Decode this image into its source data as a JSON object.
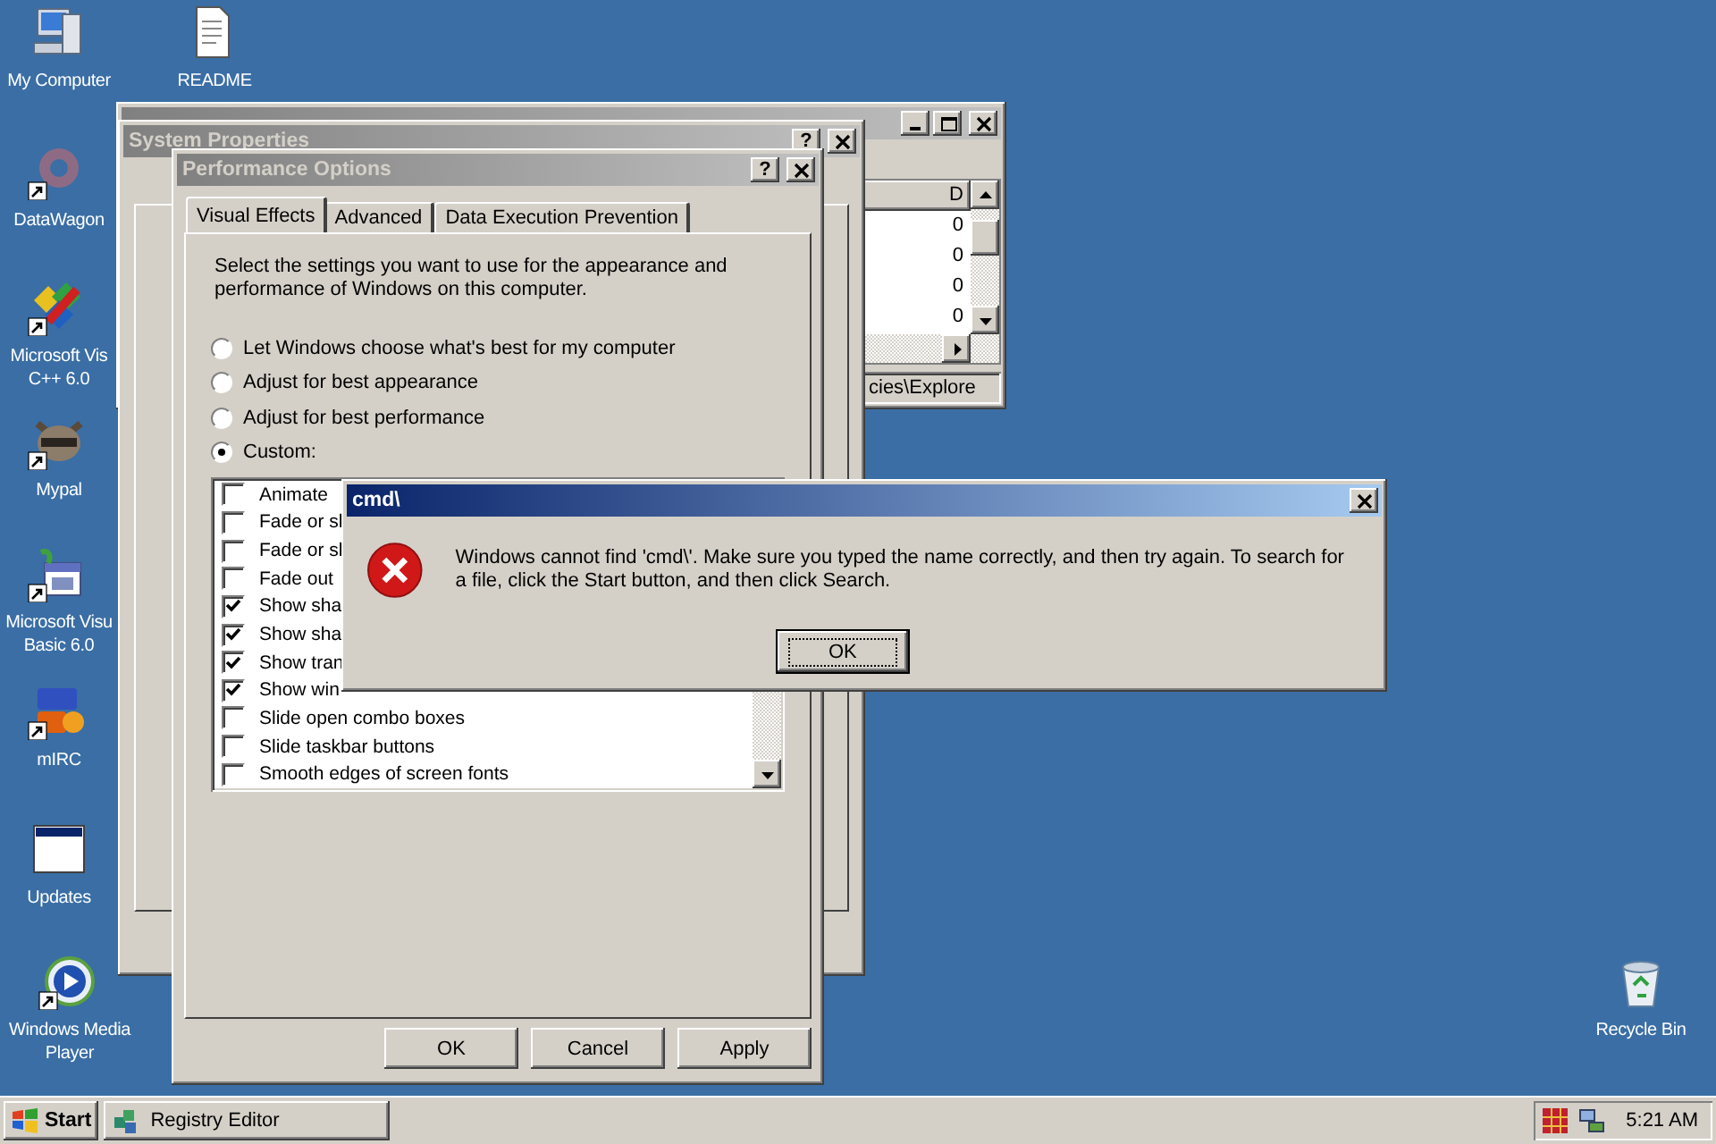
{
  "desktop_icons": [
    {
      "kind": "computer",
      "shortcut": false,
      "label_lines": [
        "My Computer"
      ]
    },
    {
      "kind": "document",
      "shortcut": false,
      "label_lines": [
        "README"
      ]
    },
    {
      "kind": "faded-disc",
      "shortcut": true,
      "label_lines": [
        "DataWagon"
      ]
    },
    {
      "kind": "tiles",
      "shortcut": true,
      "label_lines": [
        "Microsoft Vis",
        "C++ 6.0"
      ]
    },
    {
      "kind": "animal",
      "shortcut": true,
      "label_lines": [
        "Mypal"
      ]
    },
    {
      "kind": "calendar",
      "shortcut": true,
      "label_lines": [
        "Microsoft Visu",
        "Basic 6.0"
      ]
    },
    {
      "kind": "chat",
      "shortcut": true,
      "label_lines": [
        "mIRC"
      ]
    },
    {
      "kind": "window",
      "shortcut": false,
      "label_lines": [
        "Updates"
      ]
    },
    {
      "kind": "player",
      "shortcut": true,
      "label_lines": [
        "Windows Media",
        "Player"
      ]
    },
    {
      "kind": "bin",
      "shortcut": false,
      "label_lines": [
        "Recycle Bin"
      ]
    }
  ],
  "registry_editor": {
    "column_header": "D",
    "values": [
      "0",
      "0",
      "0",
      "0"
    ],
    "status": "cies\\Explore"
  },
  "system_properties": {
    "title": "System Properties",
    "help": "?"
  },
  "performance_options": {
    "title": "Performance Options",
    "help": "?",
    "tabs": [
      {
        "label": "Visual Effects",
        "selected": true
      },
      {
        "label": "Advanced",
        "selected": false
      },
      {
        "label": "Data Execution Prevention",
        "selected": false
      }
    ],
    "description": "Select the settings you want to use for the appearance and performance of Windows on this computer.",
    "radios": [
      {
        "label": "Let Windows choose what's best for my computer",
        "selected": false
      },
      {
        "label": "Adjust for best appearance",
        "selected": false
      },
      {
        "label": "Adjust for best performance",
        "selected": false
      },
      {
        "label": "Custom:",
        "selected": true
      }
    ],
    "checklist": [
      {
        "label": "Animate",
        "checked": false
      },
      {
        "label": "Fade or sl",
        "checked": false
      },
      {
        "label": "Fade or sl",
        "checked": false
      },
      {
        "label": "Fade out",
        "checked": false
      },
      {
        "label": "Show sha",
        "checked": true
      },
      {
        "label": "Show sha",
        "checked": true
      },
      {
        "label": "Show tran",
        "checked": true
      },
      {
        "label": "Show win",
        "checked": true
      },
      {
        "label": "Slide open combo boxes",
        "checked": false
      },
      {
        "label": "Slide taskbar buttons",
        "checked": false
      },
      {
        "label": "Smooth edges of screen fonts",
        "checked": false
      }
    ],
    "buttons": [
      "OK",
      "Cancel",
      "Apply"
    ]
  },
  "error_dialog": {
    "title": "cmd\\",
    "message": "Windows cannot find 'cmd\\'. Make sure you typed the name correctly, and then try again. To search for a file, click the Start button, and then click Search.",
    "button": "OK"
  },
  "taskbar": {
    "start": "Start",
    "tasks": [
      {
        "label": "Registry Editor",
        "selected": false
      }
    ],
    "clock": "5:21 AM"
  }
}
